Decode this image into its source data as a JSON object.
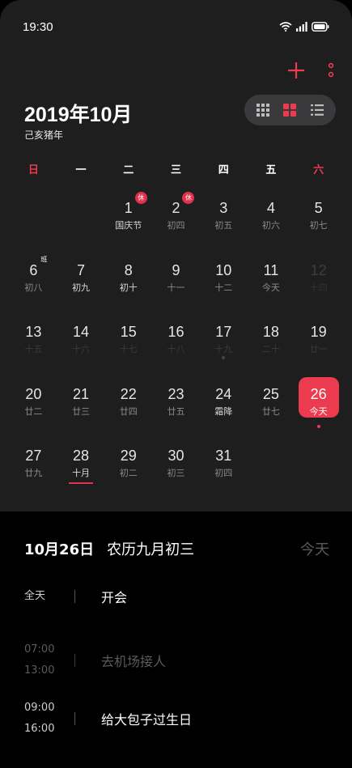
{
  "status": {
    "time": "19:30"
  },
  "toolbar": {
    "add_icon": "plus-icon",
    "more_icon": "more-vertical-icon",
    "accent": "#ec3b4f"
  },
  "header": {
    "month_title": "2019年10月",
    "lunar_year": "己亥猪年"
  },
  "view_toggle": {
    "options": [
      "grid-view-icon",
      "month-view-icon",
      "list-view-icon"
    ],
    "active": "month-view-icon"
  },
  "weekdays": [
    "日",
    "一",
    "二",
    "三",
    "四",
    "五",
    "六"
  ],
  "days": [
    {
      "num": "",
      "lunar": ""
    },
    {
      "num": "",
      "lunar": ""
    },
    {
      "num": "1",
      "lunar": "国庆节",
      "badge": "休",
      "lunar_bright": true
    },
    {
      "num": "2",
      "lunar": "初四",
      "badge": "休"
    },
    {
      "num": "3",
      "lunar": "初五"
    },
    {
      "num": "4",
      "lunar": "初六"
    },
    {
      "num": "5",
      "lunar": "初七"
    },
    {
      "num": "6",
      "lunar": "初八",
      "ban": "班"
    },
    {
      "num": "7",
      "lunar": "初九",
      "lunar_bright": true
    },
    {
      "num": "8",
      "lunar": "初十",
      "lunar_bright": true
    },
    {
      "num": "9",
      "lunar": "十一"
    },
    {
      "num": "10",
      "lunar": "十二"
    },
    {
      "num": "11",
      "lunar": "今天"
    },
    {
      "num": "12",
      "lunar": "十四",
      "faded": true
    },
    {
      "num": "13",
      "lunar": "十五",
      "faded_lunar": true
    },
    {
      "num": "14",
      "lunar": "十六",
      "faded_lunar": true
    },
    {
      "num": "15",
      "lunar": "十七",
      "faded_lunar": true
    },
    {
      "num": "16",
      "lunar": "十八",
      "faded_lunar": true
    },
    {
      "num": "17",
      "lunar": "十九",
      "faded_lunar": true,
      "dot": true
    },
    {
      "num": "18",
      "lunar": "二十",
      "faded_lunar": true
    },
    {
      "num": "19",
      "lunar": "廿一",
      "faded_lunar": true
    },
    {
      "num": "20",
      "lunar": "廿二"
    },
    {
      "num": "21",
      "lunar": "廿三"
    },
    {
      "num": "22",
      "lunar": "廿四"
    },
    {
      "num": "23",
      "lunar": "廿五"
    },
    {
      "num": "24",
      "lunar": "霜降",
      "lunar_bright": true
    },
    {
      "num": "25",
      "lunar": "廿七"
    },
    {
      "num": "26",
      "lunar": "今天",
      "selected": true,
      "dot": true
    },
    {
      "num": "27",
      "lunar": "廿九"
    },
    {
      "num": "28",
      "lunar": "十月",
      "lunar_bright": true,
      "underline": true
    },
    {
      "num": "29",
      "lunar": "初二"
    },
    {
      "num": "30",
      "lunar": "初三"
    },
    {
      "num": "31",
      "lunar": "初四"
    }
  ],
  "day_detail": {
    "date": "10月26日",
    "lunar_date": "农历九月初三",
    "today_label": "今天",
    "events": [
      {
        "times": [
          "全天"
        ],
        "title": "开会",
        "past": false
      },
      {
        "times": [
          "07:00",
          "13:00"
        ],
        "title": "去机场接人",
        "past": true
      },
      {
        "times": [
          "09:00",
          "16:00"
        ],
        "title": "给大包子过生日",
        "past": false
      }
    ]
  }
}
